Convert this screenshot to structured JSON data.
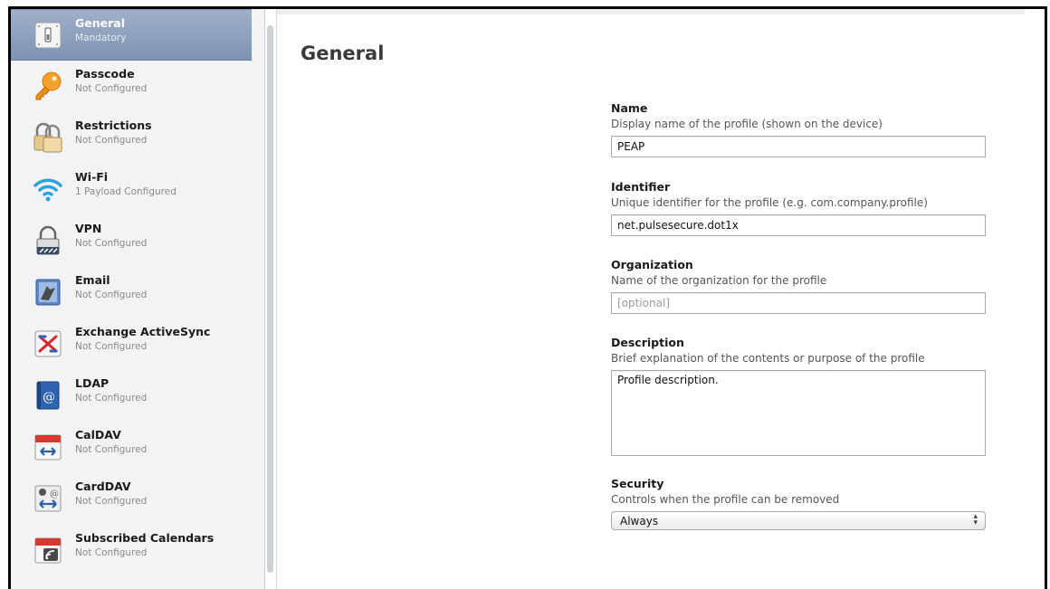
{
  "sidebar": {
    "items": [
      {
        "title": "General",
        "status": "Mandatory",
        "icon": "general-switch-icon"
      },
      {
        "title": "Passcode",
        "status": "Not Configured",
        "icon": "key-icon"
      },
      {
        "title": "Restrictions",
        "status": "Not Configured",
        "icon": "padlocks-icon"
      },
      {
        "title": "Wi-Fi",
        "status": "1 Payload Configured",
        "icon": "wifi-icon"
      },
      {
        "title": "VPN",
        "status": "Not Configured",
        "icon": "vpn-lock-icon"
      },
      {
        "title": "Email",
        "status": "Not Configured",
        "icon": "email-stamp-icon"
      },
      {
        "title": "Exchange ActiveSync",
        "status": "Not Configured",
        "icon": "exchange-icon"
      },
      {
        "title": "LDAP",
        "status": "Not Configured",
        "icon": "ldap-book-icon"
      },
      {
        "title": "CalDAV",
        "status": "Not Configured",
        "icon": "calendar-sync-icon"
      },
      {
        "title": "CardDAV",
        "status": "Not Configured",
        "icon": "contacts-sync-icon"
      },
      {
        "title": "Subscribed Calendars",
        "status": "Not Configured",
        "icon": "subscribed-calendar-icon"
      }
    ]
  },
  "main": {
    "title": "General",
    "fields": {
      "name": {
        "label": "Name",
        "help": "Display name of the profile (shown on the device)",
        "value": "PEAP"
      },
      "identifier": {
        "label": "Identifier",
        "help": "Unique identifier for the profile (e.g. com.company.profile)",
        "value": "net.pulsesecure.dot1x"
      },
      "organization": {
        "label": "Organization",
        "help": "Name of the organization for the profile",
        "placeholder": "[optional]"
      },
      "description": {
        "label": "Description",
        "help": "Brief explanation of the contents or purpose of the profile",
        "value": "Profile description."
      },
      "security": {
        "label": "Security",
        "help": "Controls when the profile can be removed",
        "value": "Always"
      }
    }
  },
  "colors": {
    "selected_bg": "#8fa2bf",
    "sidebar_bg": "#f2f3f5"
  }
}
